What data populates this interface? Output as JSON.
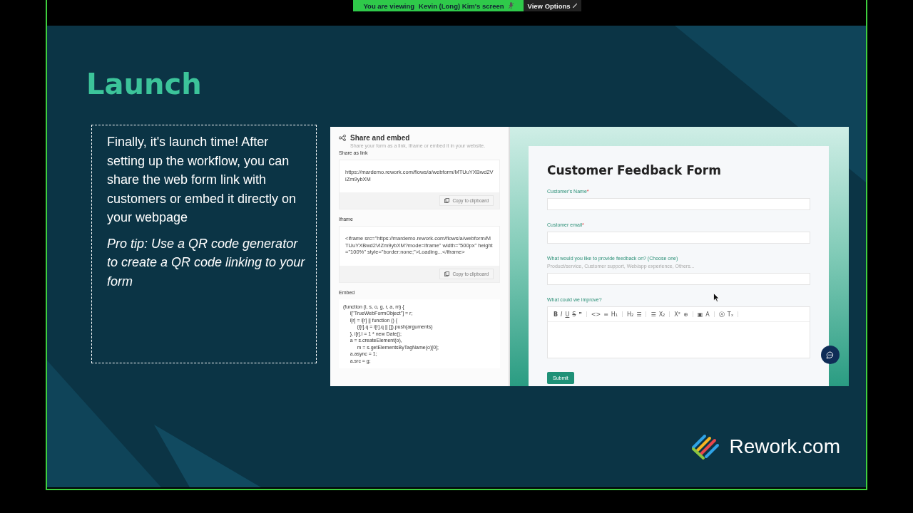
{
  "screen_share_banner": {
    "viewing_label": "You are viewing",
    "presenter": "Kevin (Long) Kim's screen",
    "view_options_button": "View Options"
  },
  "slide": {
    "title": "Launch",
    "description": "Finally, it's launch time! After setting up the workflow, you can share the web form link with customers or embed it directly on your webpage",
    "tip": "Pro tip: Use a QR code generator to create a QR code linking to your form",
    "share_panel": {
      "title": "Share and embed",
      "subtitle": "Share your form as a link, Iframe or embed it in your website.",
      "sections": [
        {
          "label": "Share as link",
          "content": "https://mardemo.rework.com/flows/a/webform/MTUuYXBwd2ViZm9ybXM",
          "button": "Copy to clipboard"
        },
        {
          "label": "Iframe",
          "content": " <iframe src=\"https://mardemo.rework.com/flows/a/webform/MTUuYXBwd2ViZm9ybXM?mode=iframe\" width=\"500px\" height=\"100%\" style=\"border:none;\">Loading...</iframe>",
          "button": "Copy to clipboard"
        },
        {
          "label": "Embed",
          "code": "(function (i, s, o, g, r, a, m) {\n     i[\"TrueWebFormObject\"] = r;\n     i[r] = i[r] || function () {\n          (i[r].q = i[r].q || []).push(arguments)\n     }, i[r].l = 1 * new Date();\n     a = s.createElement(o),\n          m = s.getElementsByTagName(o)[0];\n     a.async = 1;\n     a.src = g;"
        }
      ]
    },
    "form": {
      "title": "Customer Feedback Form",
      "fields": [
        {
          "kind": "input",
          "label": "Customer's Name",
          "required_mark": "*"
        },
        {
          "kind": "input",
          "label": "Customer email",
          "required_mark": "*"
        },
        {
          "kind": "input",
          "label": "What would you like to provide feedback on? (Choose one)",
          "hint": "Product/service, Customer support, Web/app experience, Others..."
        },
        {
          "kind": "editor",
          "label": "What could we improve?",
          "toolbar": [
            "B",
            "I",
            "U",
            "S",
            "❞",
            "<>",
            "≡",
            "H₁",
            "H₂",
            "☰",
            "☰",
            "X₂",
            "X²",
            "⊕",
            "▣",
            "A",
            "Ⓐ",
            "Tₓ"
          ]
        }
      ],
      "submit_button": "Submit"
    },
    "logo_text": "Rework.com"
  }
}
